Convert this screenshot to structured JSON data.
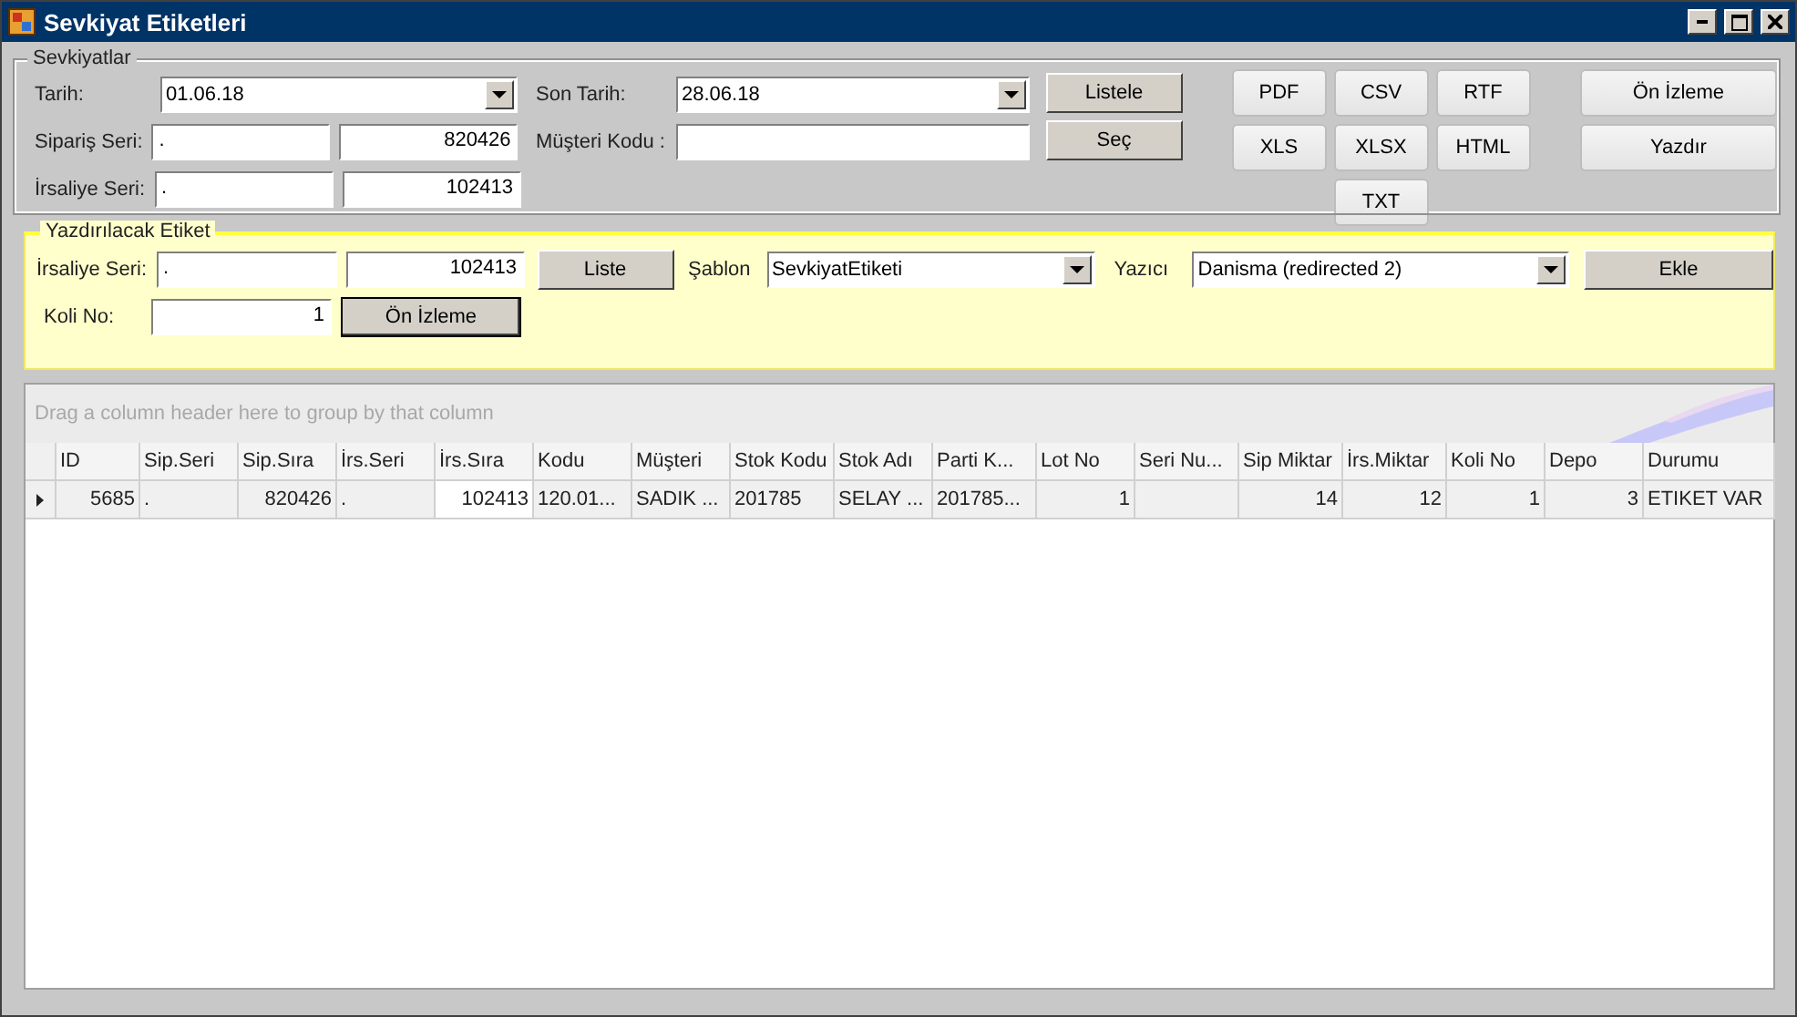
{
  "window": {
    "title": "Sevkiyat Etiketleri"
  },
  "sevkiyatlar": {
    "legend": "Sevkiyatlar",
    "tarih": {
      "label": "Tarih:",
      "value": "01.06.18"
    },
    "siparis_seri": {
      "label": "Sipariş Seri:",
      "seri": ".",
      "sira": "820426"
    },
    "irsaliye_seri": {
      "label": "İrsaliye Seri:",
      "seri": ".",
      "sira": "102413"
    },
    "son_tarih": {
      "label": "Son Tarih:",
      "value": "28.06.18"
    },
    "musteri_kodu": {
      "label": "Müşteri Kodu :"
    },
    "buttons": [
      "Listele",
      "Seç"
    ]
  },
  "export_buttons": [
    "PDF",
    "CSV",
    "RTF",
    "XLS",
    "XLSX",
    "HTML",
    "TXT"
  ],
  "print_buttons": [
    "Ön İzleme",
    "Yazdır"
  ],
  "label_panel": {
    "legend": "Yazdırılacak Etiket",
    "irsaliye_seri": {
      "label": "İrsaliye Seri:",
      "seri": ".",
      "sira": "102413"
    },
    "liste_button": "Liste",
    "sablon": {
      "label": "Şablon",
      "value": "SevkiyatEtiketi"
    },
    "yazici": {
      "label": "Yazıcı",
      "value": "Danisma (redirected 2)"
    },
    "ekle_button": "Ekle",
    "koli_no": {
      "label": "Koli No:",
      "value": "1"
    },
    "preview_button": "Ön İzleme"
  },
  "grid": {
    "group_panel_hint": "Drag a column header here to group by that column",
    "columns": [
      {
        "label": "ID",
        "kind": "number"
      },
      {
        "label": "Sip.Seri",
        "kind": "text"
      },
      {
        "label": "Sip.Sıra",
        "kind": "number"
      },
      {
        "label": "İrs.Seri",
        "kind": "text"
      },
      {
        "label": "İrs.Sıra",
        "kind": "number"
      },
      {
        "label": "Kodu",
        "kind": "text"
      },
      {
        "label": "Müşteri",
        "kind": "text"
      },
      {
        "label": "Stok Kodu",
        "kind": "text"
      },
      {
        "label": "Stok Adı",
        "kind": "text"
      },
      {
        "label": "Parti K...",
        "kind": "text"
      },
      {
        "label": "Lot No",
        "kind": "number"
      },
      {
        "label": "Seri Nu...",
        "kind": "text"
      },
      {
        "label": "Sip Miktar",
        "kind": "number"
      },
      {
        "label": "İrs.Miktar",
        "kind": "number"
      },
      {
        "label": "Koli No",
        "kind": "number"
      },
      {
        "label": "Depo",
        "kind": "number"
      },
      {
        "label": "Durumu",
        "kind": "text"
      }
    ],
    "rows": [
      {
        "selected": true,
        "cells": [
          {
            "text": "5685",
            "focused": false
          },
          {
            "text": ".",
            "focused": false
          },
          {
            "text": "820426",
            "focused": false
          },
          {
            "text": ".",
            "focused": false
          },
          {
            "text": "102413",
            "focused": true
          },
          {
            "text": "120.01...",
            "focused": false
          },
          {
            "text": "SADIK ...",
            "focused": false
          },
          {
            "text": "201785",
            "focused": false
          },
          {
            "text": "SELAY ...",
            "focused": false
          },
          {
            "text": "201785...",
            "focused": false
          },
          {
            "text": "1",
            "focused": false
          },
          {
            "focused": false
          },
          {
            "text": "14",
            "focused": false
          },
          {
            "text": "12",
            "focused": false
          },
          {
            "text": "1",
            "focused": false
          },
          {
            "text": "3",
            "focused": false
          },
          {
            "text": "ETIKET VAR",
            "focused": false
          }
        ]
      }
    ]
  }
}
